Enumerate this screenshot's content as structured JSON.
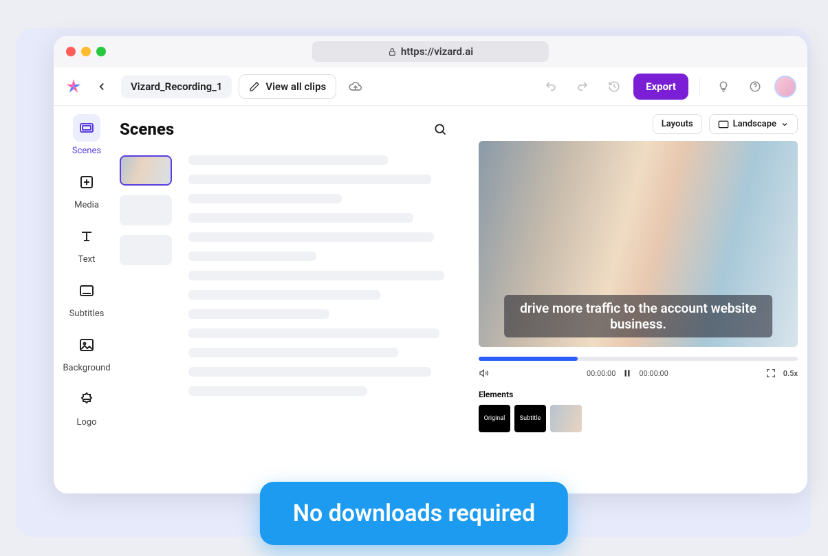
{
  "url": "https://vizard.ai",
  "breadcrumb": "Vizard_Recording_1",
  "view_all": "View all clips",
  "export": "Export",
  "sidebar": [
    {
      "id": "scenes",
      "label": "Scenes"
    },
    {
      "id": "media",
      "label": "Media"
    },
    {
      "id": "text",
      "label": "Text"
    },
    {
      "id": "subtitles",
      "label": "Subtitles"
    },
    {
      "id": "background",
      "label": "Background"
    },
    {
      "id": "logo",
      "label": "Logo"
    }
  ],
  "panel_title": "Scenes",
  "layouts": "Layouts",
  "orientation": "Landscape",
  "caption": "drive more traffic to the account website business.",
  "time_a": "00:00:00",
  "time_b": "00:00:00",
  "speed": "0.5x",
  "elements_label": "Elements",
  "el_original": "Original",
  "el_subtitle": "Subtitle",
  "banner": "No downloads required"
}
